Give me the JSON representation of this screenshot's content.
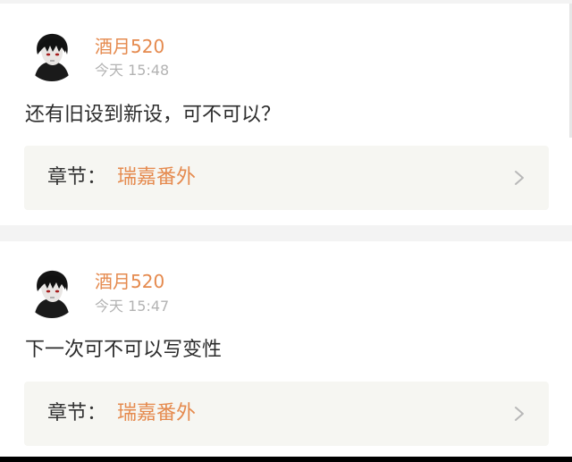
{
  "comments": [
    {
      "username": "酒月520",
      "time": "今天 15:48",
      "text": "还有旧设到新设，可不可以？",
      "chapter_prefix": "章节：",
      "chapter_name": "瑞嘉番外",
      "avatar_icon": "dark-haired-character-avatar",
      "chevron_icon": "chevron-right-icon"
    },
    {
      "username": "酒月520",
      "time": "今天 15:47",
      "text": "下一次可不可以写变性",
      "chapter_prefix": "章节：",
      "chapter_name": "瑞嘉番外",
      "avatar_icon": "dark-haired-character-avatar",
      "chevron_icon": "chevron-right-icon"
    }
  ],
  "colors": {
    "accent": "#e58a4e",
    "muted": "#b3b3b3",
    "text": "#2b2b2b",
    "chapter_bg": "#f6f6f2",
    "page_bg": "#f3f3f3"
  }
}
